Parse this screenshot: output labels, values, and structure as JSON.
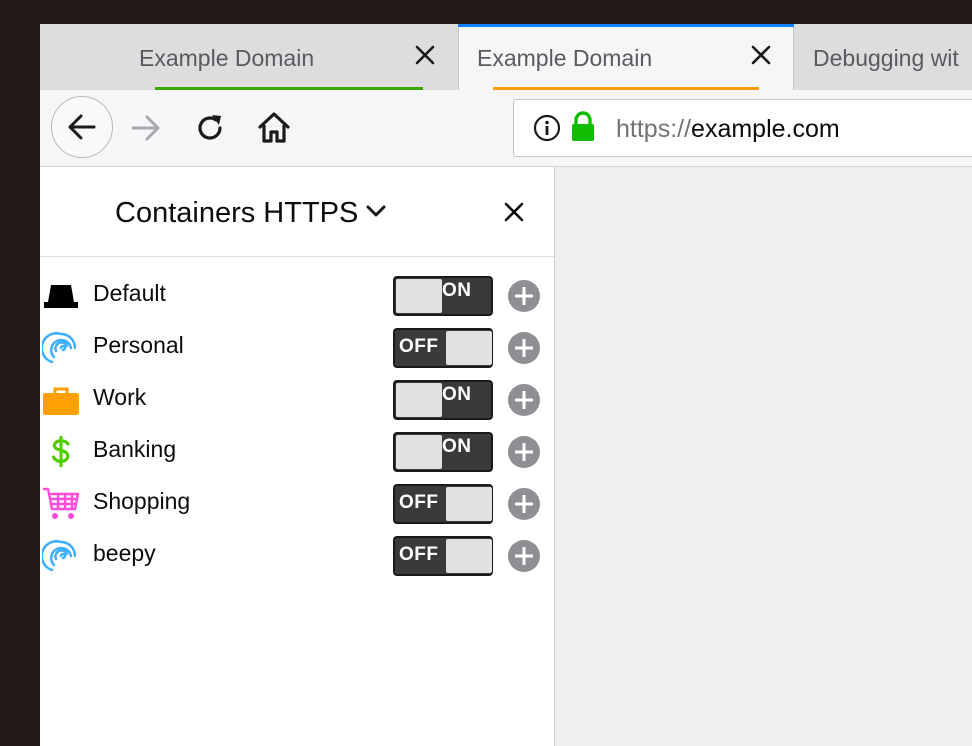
{
  "tabs": [
    {
      "title": "Example Domain",
      "state": "inactive",
      "indicator_color": "#3ea600"
    },
    {
      "title": "Example Domain",
      "state": "active",
      "indicator_color": "#f89c0e"
    },
    {
      "title": "Debugging wit",
      "state": "inactive",
      "indicator_color": ""
    }
  ],
  "urlbar": {
    "scheme": "https://",
    "host": "example.com",
    "icons": [
      "info-icon",
      "lock-icon"
    ],
    "lock_color": "#12bc00"
  },
  "sidebar": {
    "title": "Containers HTTPS",
    "containers": [
      {
        "name": "Default",
        "icon": "hat-icon",
        "color": "#000000",
        "toggle": "ON"
      },
      {
        "name": "Personal",
        "icon": "fingerprint-icon",
        "color": "#37adff",
        "toggle": "OFF"
      },
      {
        "name": "Work",
        "icon": "briefcase-icon",
        "color": "#ff9f00",
        "toggle": "ON"
      },
      {
        "name": "Banking",
        "icon": "dollar-icon",
        "color": "#51cd00",
        "toggle": "ON"
      },
      {
        "name": "Shopping",
        "icon": "cart-icon",
        "color": "#ff4bda",
        "toggle": "OFF"
      },
      {
        "name": "beepy",
        "icon": "fingerprint-icon",
        "color": "#37adff",
        "toggle": "OFF"
      }
    ]
  },
  "colors": {
    "active_tab_top": "#0a84ff",
    "toggle_bg": "#3a3a3c",
    "add_button": "#8f8f93"
  }
}
